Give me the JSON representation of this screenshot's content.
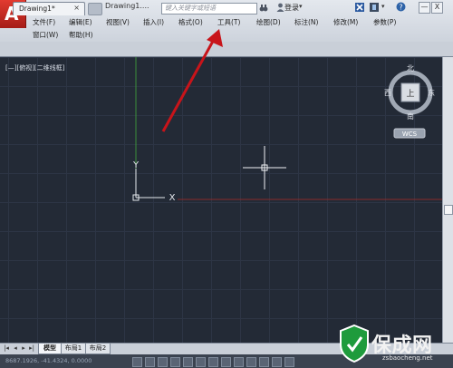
{
  "app": {
    "logo_letter": "A",
    "title": "Drawing1....",
    "search_placeholder": "键入关键字或短语",
    "login_label": "登录"
  },
  "menu": {
    "row1": [
      "文件(F)",
      "编辑(E)",
      "视图(V)",
      "插入(I)",
      "格式(O)",
      "工具(T)",
      "绘图(D)",
      "标注(N)",
      "修改(M)",
      "参数(P)"
    ],
    "row2": [
      "窗口(W)",
      "帮助(H)"
    ]
  },
  "window_controls": [
    "?",
    "—",
    "X"
  ],
  "tabs": {
    "document_tab": "Drawing1*",
    "close_glyph": "×"
  },
  "viewport": {
    "view_controls": "[—][俯视][二维线框]",
    "ucs_y_label": "Y",
    "ucs_x_label": "X"
  },
  "viewcube": {
    "north": "北",
    "south": "南",
    "east": "东",
    "west": "西",
    "top_face": "上",
    "wcs_label": "WCS"
  },
  "layout_tabs": [
    "模型",
    "布局1",
    "布局2"
  ],
  "status": {
    "coords": "8687.1926, -41.4324, 0.0000"
  },
  "watermark": {
    "brand": "保成网",
    "url": "zsbaocheng.net"
  },
  "colors": {
    "canvas_bg": "#232a36",
    "grid": "#2d3545",
    "axis_y": "#3b8f3b",
    "axis_x": "#8a2a2a",
    "annotation_arrow": "#c8141a",
    "app_button": "#c8261c",
    "watermark_green": "#1e9b3c"
  },
  "icons": [
    "new-file-icon",
    "open-folder-icon",
    "save-icon",
    "binoculars-icon",
    "user-icon",
    "exchange-icon",
    "help-icon",
    "new-tab-icon"
  ]
}
